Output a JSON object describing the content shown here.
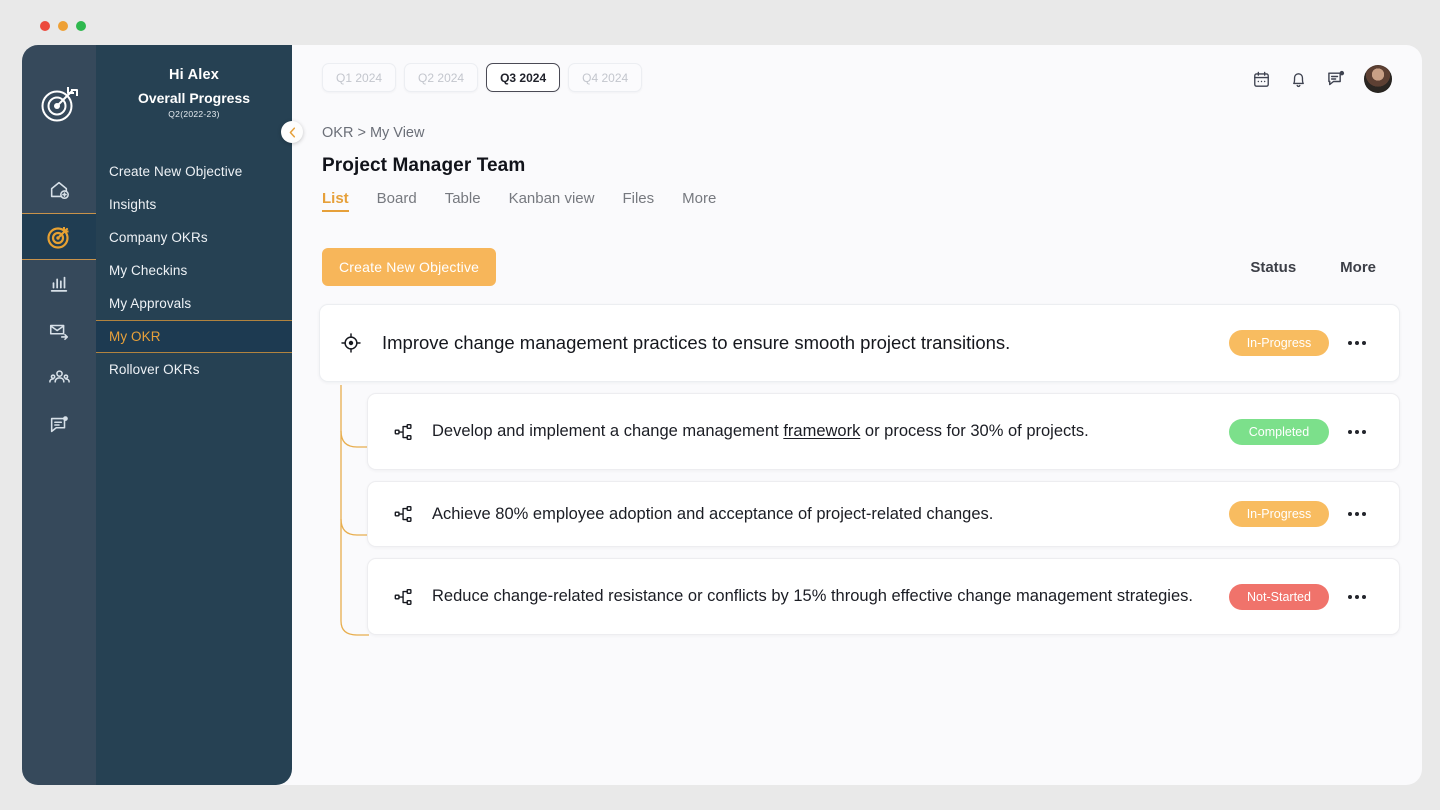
{
  "window": {
    "traffic_lights": [
      "close",
      "minimize",
      "maximize"
    ]
  },
  "rail": {
    "logo_icon": "target-logo-icon",
    "items": [
      {
        "name": "home-add",
        "icon": "home-add-icon",
        "active": false
      },
      {
        "name": "okr",
        "icon": "target-icon",
        "active": true
      },
      {
        "name": "analytics",
        "icon": "bar-chart-icon",
        "active": false
      },
      {
        "name": "mail",
        "icon": "mail-forward-icon",
        "active": false
      },
      {
        "name": "team",
        "icon": "people-icon",
        "active": false
      },
      {
        "name": "feedback",
        "icon": "note-edit-icon",
        "active": false
      }
    ]
  },
  "nav": {
    "greeting": "Hi Alex",
    "progress_label": "Overall Progress",
    "progress_period": "Q2(2022-23)",
    "collapse_icon": "chevron-left-icon",
    "items": [
      {
        "label": "Create New Objective",
        "active": false
      },
      {
        "label": "Insights",
        "active": false
      },
      {
        "label": "Company OKRs",
        "active": false
      },
      {
        "label": "My  Checkins",
        "active": false
      },
      {
        "label": "My Approvals",
        "active": false
      },
      {
        "label": "My OKR",
        "active": true
      },
      {
        "label": "Rollover OKRs",
        "active": false
      }
    ]
  },
  "header": {
    "quarters": [
      {
        "label": "Q1 2024",
        "active": false
      },
      {
        "label": "Q2 2024",
        "active": false
      },
      {
        "label": "Q3 2024",
        "active": true
      },
      {
        "label": "Q4 2024",
        "active": false
      }
    ],
    "icons": [
      {
        "name": "calendar-icon"
      },
      {
        "name": "bell-icon"
      },
      {
        "name": "message-icon",
        "badge": true
      }
    ],
    "avatar": "user-avatar"
  },
  "breadcrumb": "OKR > My View",
  "page_title": "Project Manager Team",
  "view_tabs": [
    {
      "label": "List",
      "active": true
    },
    {
      "label": "Board",
      "active": false
    },
    {
      "label": "Table",
      "active": false
    },
    {
      "label": "Kanban view",
      "active": false
    },
    {
      "label": "Files",
      "active": false
    },
    {
      "label": "More",
      "active": false
    }
  ],
  "actions": {
    "create_objective": "Create New Objective",
    "col_status": "Status",
    "col_more": "More"
  },
  "objective": {
    "icon": "crosshair-target-icon",
    "text": "Improve change management practices to ensure smooth project transitions.",
    "status": "In-Progress",
    "status_class": "badge-inprogress",
    "more_icon": "ellipsis-icon"
  },
  "key_results": [
    {
      "icon": "hierarchy-icon",
      "text_before": "Develop and implement a change management ",
      "text_link": "framework",
      "text_after": " or process for 30% of projects.",
      "status": "Completed",
      "status_class": "badge-completed",
      "lines": "two-line",
      "more_icon": "ellipsis-icon"
    },
    {
      "icon": "hierarchy-icon",
      "text_before": "Achieve 80% employee adoption and acceptance of project-related changes.",
      "text_link": "",
      "text_after": "",
      "status": "In-Progress",
      "status_class": "badge-inprogress",
      "lines": "one-line",
      "more_icon": "ellipsis-icon"
    },
    {
      "icon": "hierarchy-icon",
      "text_before": "Reduce change-related resistance or conflicts by 15% through effective change management strategies.",
      "text_link": "",
      "text_after": "",
      "status": "Not-Started",
      "status_class": "badge-notstarted",
      "lines": "two-line",
      "more_icon": "ellipsis-icon"
    }
  ],
  "colors": {
    "rail_bg": "#36495b",
    "nav_bg": "#264153",
    "accent": "#e6a03a",
    "button": "#f7b65a",
    "completed": "#7ce08b",
    "in_progress": "#f8bc60",
    "not_started": "#f0736b",
    "content_bg": "#fafafc"
  }
}
